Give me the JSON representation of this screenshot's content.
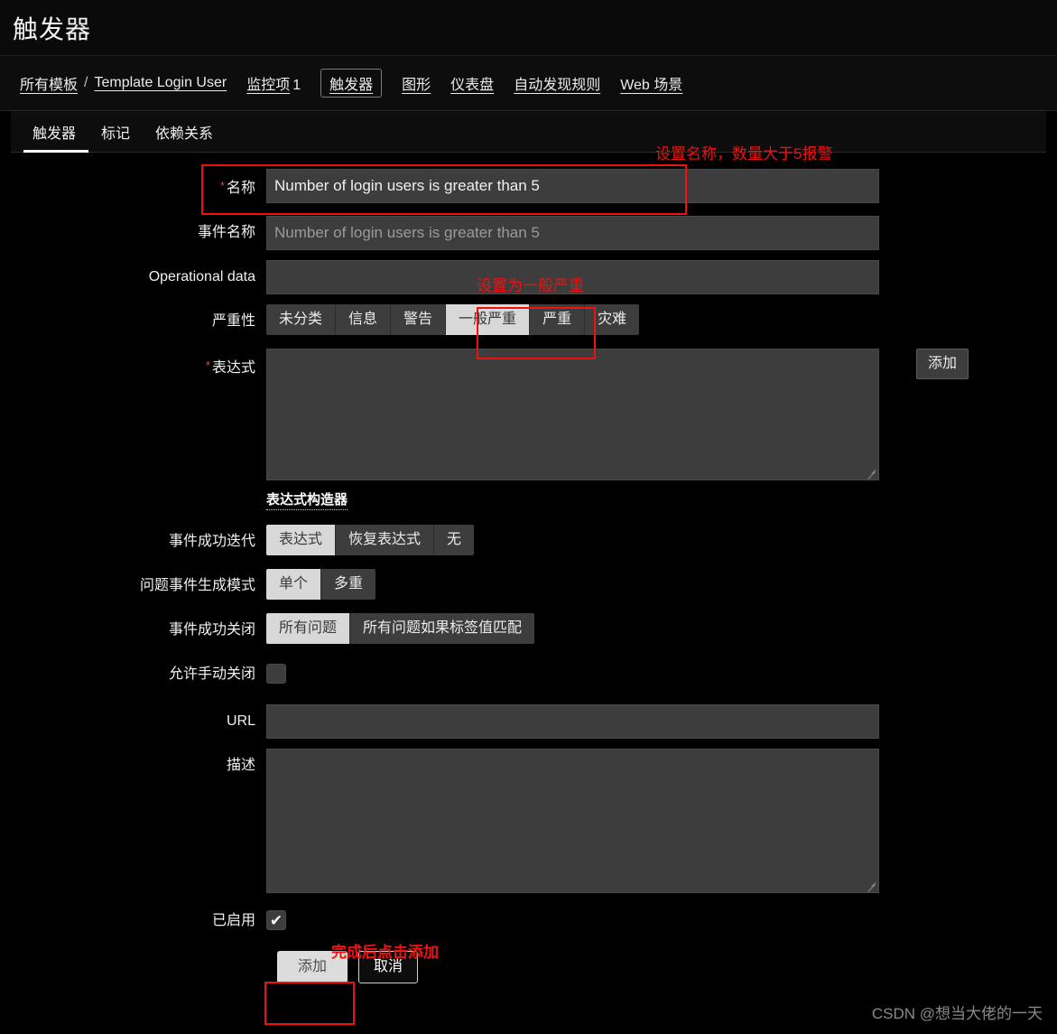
{
  "header": {
    "title": "触发器"
  },
  "nav": {
    "breadcrumb": [
      {
        "label": "所有模板",
        "active": false
      },
      {
        "label": "Template Login User",
        "active": false
      }
    ],
    "separator": "/",
    "items": [
      {
        "label": "监控项",
        "count": "1",
        "active": false
      },
      {
        "label": "触发器",
        "count": "",
        "active": true
      },
      {
        "label": "图形",
        "count": "",
        "active": false
      },
      {
        "label": "仪表盘",
        "count": "",
        "active": false
      },
      {
        "label": "自动发现规则",
        "count": "",
        "active": false
      },
      {
        "label": "Web 场景",
        "count": "",
        "active": false
      }
    ]
  },
  "tabs": [
    {
      "label": "触发器",
      "active": true
    },
    {
      "label": "标记",
      "active": false
    },
    {
      "label": "依赖关系",
      "active": false
    }
  ],
  "form": {
    "name": {
      "label": "名称",
      "required": "*",
      "value": "Number of login users is greater than 5"
    },
    "event_name": {
      "label": "事件名称",
      "placeholder": "Number of login users is greater than 5",
      "value": ""
    },
    "operational_data": {
      "label": "Operational data",
      "value": ""
    },
    "severity": {
      "label": "严重性",
      "options": [
        "未分类",
        "信息",
        "警告",
        "一般严重",
        "严重",
        "灾难"
      ],
      "selected": "一般严重"
    },
    "expression": {
      "label": "表达式",
      "required": "*",
      "value": "",
      "add_button": "添加",
      "builder_link": "表达式构造器"
    },
    "event_generation": {
      "label": "事件成功迭代",
      "options": [
        "表达式",
        "恢复表达式",
        "无"
      ],
      "selected": "表达式"
    },
    "problem_event_mode": {
      "label": "问题事件生成模式",
      "options": [
        "单个",
        "多重"
      ],
      "selected": "单个"
    },
    "event_close": {
      "label": "事件成功关闭",
      "options": [
        "所有问题",
        "所有问题如果标签值匹配"
      ],
      "selected": "所有问题"
    },
    "allow_manual_close": {
      "label": "允许手动关闭",
      "checked": false,
      "mark": "✔"
    },
    "url": {
      "label": "URL",
      "value": ""
    },
    "description": {
      "label": "描述",
      "value": ""
    },
    "enabled": {
      "label": "已启用",
      "checked": true,
      "mark": "✔"
    }
  },
  "footer": {
    "submit_label": "添加",
    "cancel_label": "取消"
  },
  "annotations": {
    "name_note": "设置名称，数量大于5报警",
    "severity_note": "设置为一般严重",
    "submit_note": "完成后点击添加"
  },
  "watermark": "CSDN @想当大佬的一天",
  "colors": {
    "annotation": "#ee1111",
    "background": "#000000",
    "input": "#3d3d3d",
    "selected": "#d8d8d8"
  }
}
